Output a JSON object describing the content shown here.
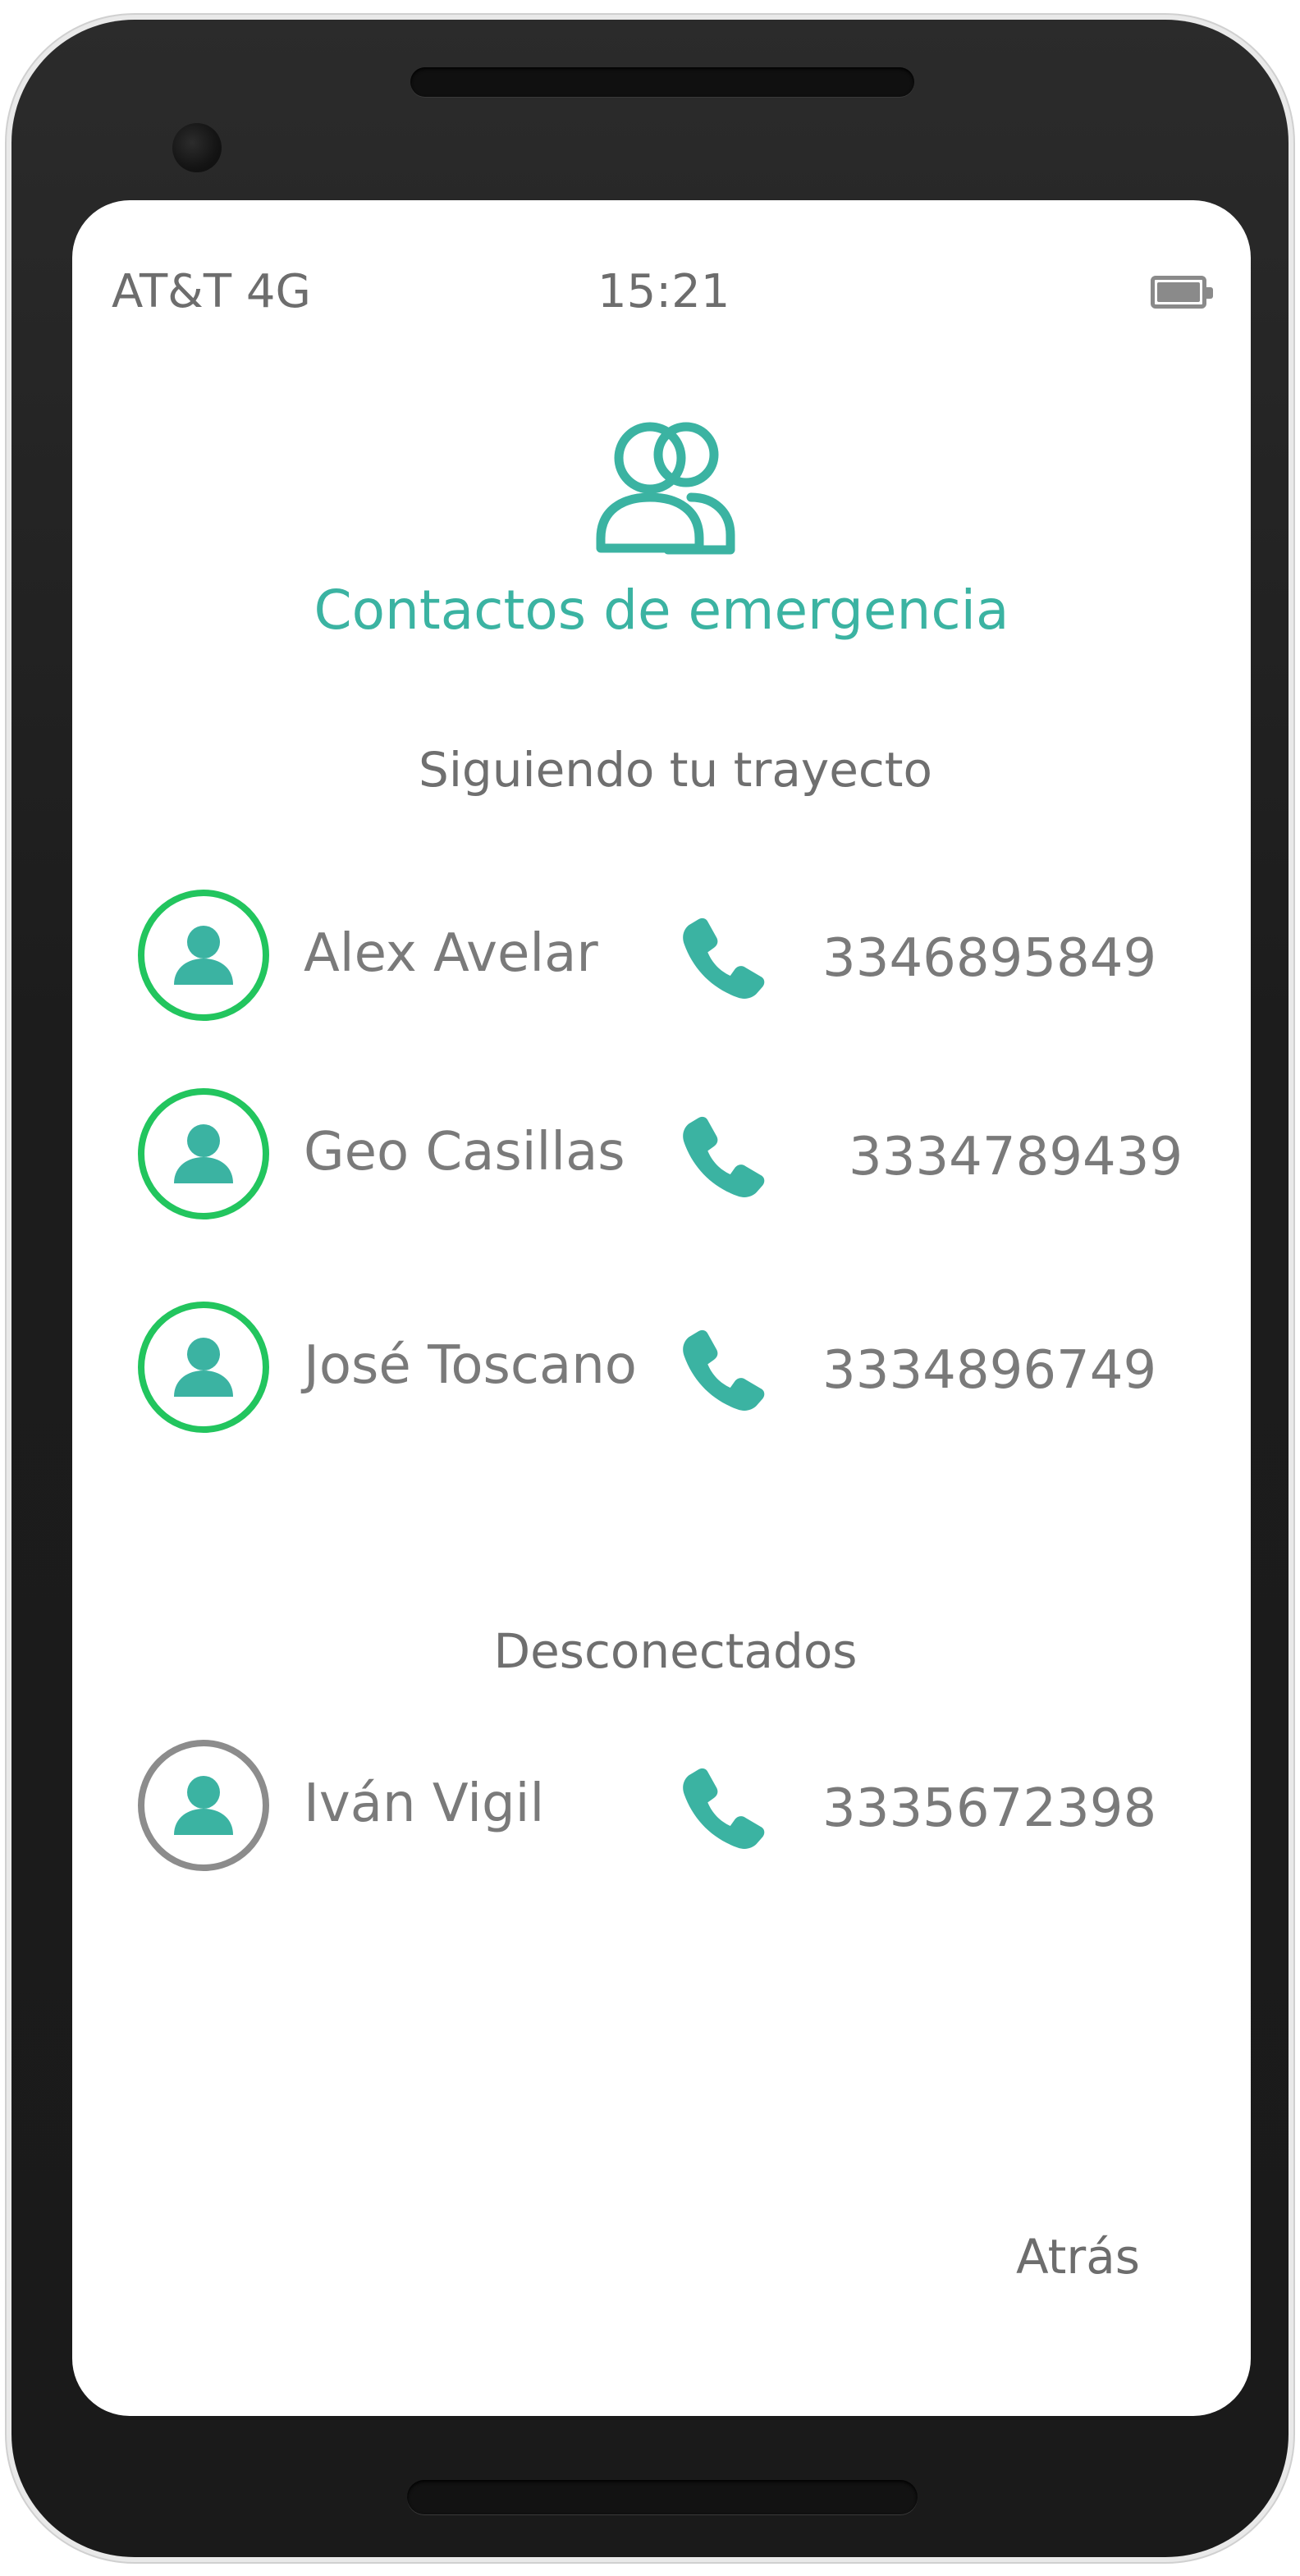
{
  "status_bar": {
    "carrier": "AT&T 4G",
    "time": "15:21",
    "battery_icon": "battery-icon"
  },
  "header": {
    "icon": "group-users-icon",
    "title": "Contactos de emergencia"
  },
  "sections": [
    {
      "title": "Siguiendo tu trayecto",
      "status": "online",
      "contacts": [
        {
          "name": "Alex Avelar",
          "phone": "3346895849"
        },
        {
          "name": "Geo Casillas",
          "phone": "3334789439"
        },
        {
          "name": "José Toscano",
          "phone": "3334896749"
        }
      ]
    },
    {
      "title": "Desconectados",
      "status": "offline",
      "contacts": [
        {
          "name": "Iván Vigil",
          "phone": "3335672398"
        }
      ]
    }
  ],
  "footer": {
    "back_label": "Atrás"
  },
  "colors": {
    "accent": "#3bb3a2",
    "online_ring": "#22c55e",
    "offline_ring": "#8c8c8c",
    "text": "#7a7a7a"
  }
}
